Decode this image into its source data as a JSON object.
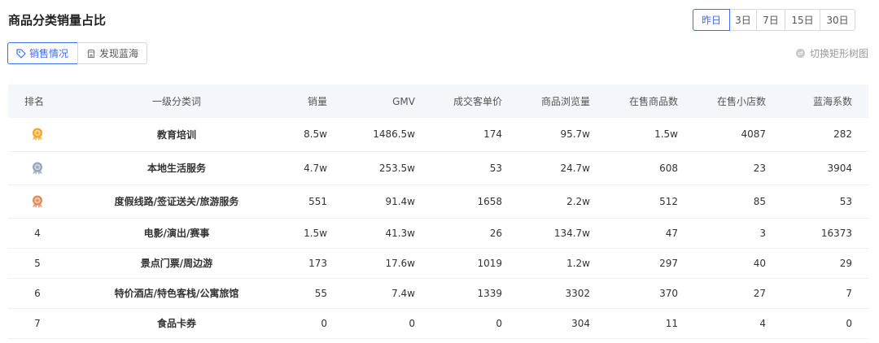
{
  "header": {
    "title": "商品分类销量占比"
  },
  "periods": {
    "items": [
      "昨日",
      "3日",
      "7日",
      "15日",
      "30日"
    ],
    "active": 0
  },
  "view_tabs": {
    "sales": "销售情况",
    "blue_ocean": "发现蓝海"
  },
  "switch_link": {
    "label": "切换矩形树图"
  },
  "table": {
    "headers": {
      "rank": "排名",
      "category": "一级分类词",
      "sales": "销量",
      "gmv": "GMV",
      "avg_price": "成交客单价",
      "views": "商品浏览量",
      "products": "在售商品数",
      "shops": "在售小店数",
      "blue_ocean": "蓝海系数"
    },
    "rows": [
      {
        "rank": "1",
        "medal": "gold",
        "category": "教育培训",
        "sales": "8.5w",
        "gmv": "1486.5w",
        "avg_price": "174",
        "views": "95.7w",
        "products": "1.5w",
        "shops": "4087",
        "blue_ocean": "282"
      },
      {
        "rank": "2",
        "medal": "silver",
        "category": "本地生活服务",
        "sales": "4.7w",
        "gmv": "253.5w",
        "avg_price": "53",
        "views": "24.7w",
        "products": "608",
        "shops": "23",
        "blue_ocean": "3904"
      },
      {
        "rank": "3",
        "medal": "bronze",
        "category": "度假线路/签证送关/旅游服务",
        "sales": "551",
        "gmv": "91.4w",
        "avg_price": "1658",
        "views": "2.2w",
        "products": "512",
        "shops": "85",
        "blue_ocean": "53"
      },
      {
        "rank": "4",
        "medal": "",
        "category": "电影/演出/赛事",
        "sales": "1.5w",
        "gmv": "41.3w",
        "avg_price": "26",
        "views": "134.7w",
        "products": "47",
        "shops": "3",
        "blue_ocean": "16373"
      },
      {
        "rank": "5",
        "medal": "",
        "category": "景点门票/周边游",
        "sales": "173",
        "gmv": "17.6w",
        "avg_price": "1019",
        "views": "1.2w",
        "products": "297",
        "shops": "40",
        "blue_ocean": "29"
      },
      {
        "rank": "6",
        "medal": "",
        "category": "特价酒店/特色客栈/公寓旅馆",
        "sales": "55",
        "gmv": "7.4w",
        "avg_price": "1339",
        "views": "3302",
        "products": "370",
        "shops": "27",
        "blue_ocean": "7"
      },
      {
        "rank": "7",
        "medal": "",
        "category": "食品卡券",
        "sales": "0",
        "gmv": "0",
        "avg_price": "0",
        "views": "304",
        "products": "11",
        "shops": "4",
        "blue_ocean": "0"
      }
    ]
  },
  "colors": {
    "accent": "#3d6cf5",
    "header_bg": "#f4f6fa",
    "gold": "#f5a623",
    "silver": "#9aa4b8",
    "bronze": "#e08a5a"
  }
}
